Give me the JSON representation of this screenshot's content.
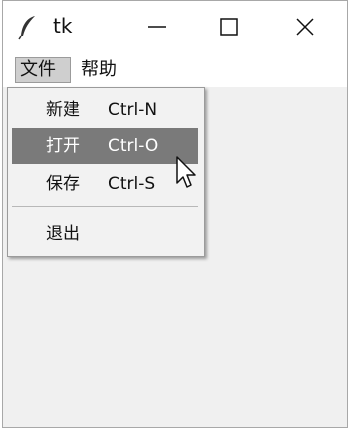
{
  "window": {
    "title": "tk"
  },
  "menubar": {
    "items": [
      {
        "label": "文件"
      },
      {
        "label": "帮助"
      }
    ]
  },
  "dropdown": {
    "items": [
      {
        "label": "新建",
        "accelerator": "Ctrl-N",
        "highlighted": false
      },
      {
        "label": "打开",
        "accelerator": "Ctrl-O",
        "highlighted": true
      },
      {
        "label": "保存",
        "accelerator": "Ctrl-S",
        "highlighted": false
      },
      {
        "label": "退出",
        "accelerator": "",
        "highlighted": false
      }
    ]
  },
  "icons": {
    "app": "feather-icon",
    "minimize": "minimize-icon",
    "maximize": "maximize-icon",
    "close": "close-icon",
    "cursor": "pointer-cursor-icon"
  },
  "colors": {
    "highlight": "#7a7a7a",
    "window_bg": "#f0f0f0"
  }
}
